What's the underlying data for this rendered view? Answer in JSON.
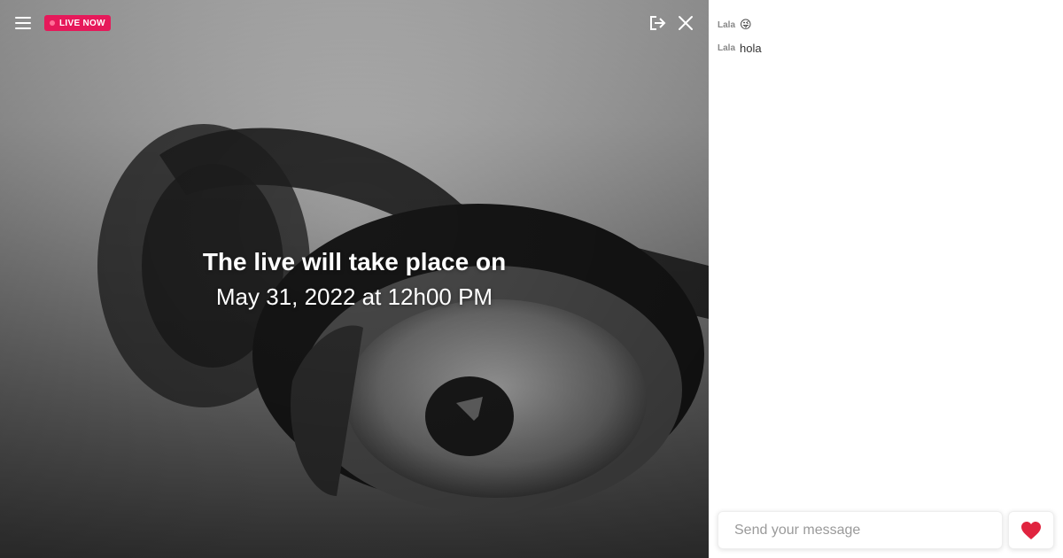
{
  "stage": {
    "live_label": "LIVE NOW",
    "announce_title": "The live will take place on",
    "announce_date": "May 31, 2022 at 12h00 PM",
    "icons": {
      "menu": "hamburger-menu-icon",
      "exit": "exit-icon",
      "close": "close-icon"
    }
  },
  "chat": {
    "messages": [
      {
        "author": "Lala",
        "text": "😜"
      },
      {
        "author": "Lala",
        "text": "hola"
      }
    ],
    "input_placeholder": "Send your message",
    "like_icon": "heart-icon"
  },
  "colors": {
    "live_badge": "#e6195a",
    "heart": "#e0243f",
    "panel_background": "#ffffff"
  }
}
